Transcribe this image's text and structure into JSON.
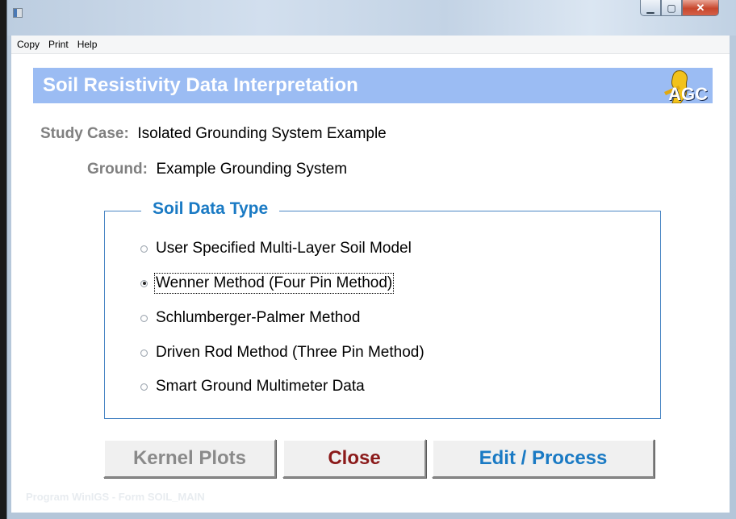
{
  "window": {
    "title": ""
  },
  "menu": [
    "Copy",
    "Print",
    "Help"
  ],
  "banner": {
    "title": "Soil Resistivity Data Interpretation",
    "logo_text": "AGC"
  },
  "fields": [
    {
      "label": "Study Case:",
      "value": "Isolated Grounding System Example"
    },
    {
      "label": "Ground:",
      "value": "Example Grounding System"
    }
  ],
  "soil_data_type": {
    "title": "Soil Data Type",
    "options": [
      "User Specified Multi-Layer Soil Model",
      "Wenner Method (Four Pin Method)",
      "Schlumberger-Palmer Method",
      "Driven Rod Method (Three Pin Method)",
      "Smart Ground Multimeter Data"
    ],
    "selected": "Wenner Method (Four Pin Method)"
  },
  "buttons": {
    "kernel": "Kernel Plots",
    "close": "Close",
    "edit": "Edit / Process"
  },
  "status": "Program WinIGS - Form SOIL_MAIN",
  "colors": {
    "banner": "#9bbcf3",
    "group_title": "#1a7ac4",
    "close_text": "#8b1a1a",
    "edit_text": "#1a7ac4",
    "disabled_text": "#8a8a8a"
  }
}
